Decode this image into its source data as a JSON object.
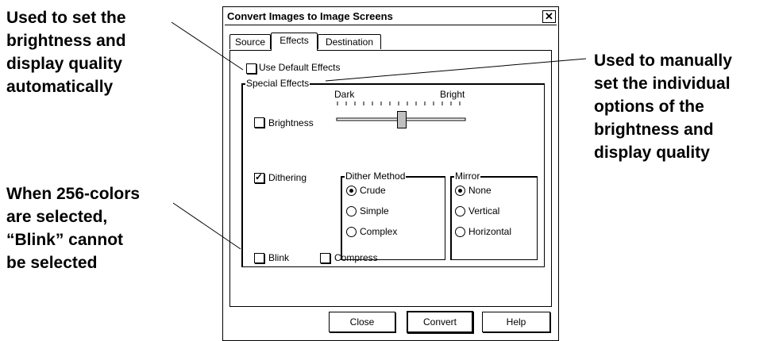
{
  "callouts": {
    "top_left": [
      "Used to set the",
      "brightness and",
      "display quality",
      "automatically"
    ],
    "bottom_left": [
      "When 256-colors",
      "are selected,",
      "“Blink” cannot",
      "be selected"
    ],
    "right": [
      "Used to manually",
      "set the individual",
      "options of the",
      "brightness and",
      "display quality"
    ]
  },
  "dialog": {
    "title": "Convert Images to Image Screens",
    "close_symbol": "✕",
    "tabs": [
      "Source",
      "Effects",
      "Destination"
    ],
    "active_tab": "Effects",
    "use_default_effects": {
      "label": "Use Default Effects",
      "checked": false
    },
    "special_effects": {
      "legend": "Special Effects",
      "brightness": {
        "label": "Brightness",
        "checked": false,
        "min_label": "Dark",
        "max_label": "Bright",
        "level": 0.5
      },
      "dithering": {
        "label": "Dithering",
        "checked": true
      },
      "dither_method": {
        "legend": "Dither Method",
        "options": [
          "Crude",
          "Simple",
          "Complex"
        ],
        "selected": "Crude"
      },
      "mirror": {
        "legend": "Mirror",
        "options": [
          "None",
          "Vertical",
          "Horizontal"
        ],
        "selected": "None"
      },
      "blink": {
        "label": "Blink",
        "checked": false
      },
      "compress": {
        "label": "Compress",
        "checked": false
      }
    },
    "buttons": {
      "close": "Close",
      "convert": "Convert",
      "help": "Help"
    }
  }
}
